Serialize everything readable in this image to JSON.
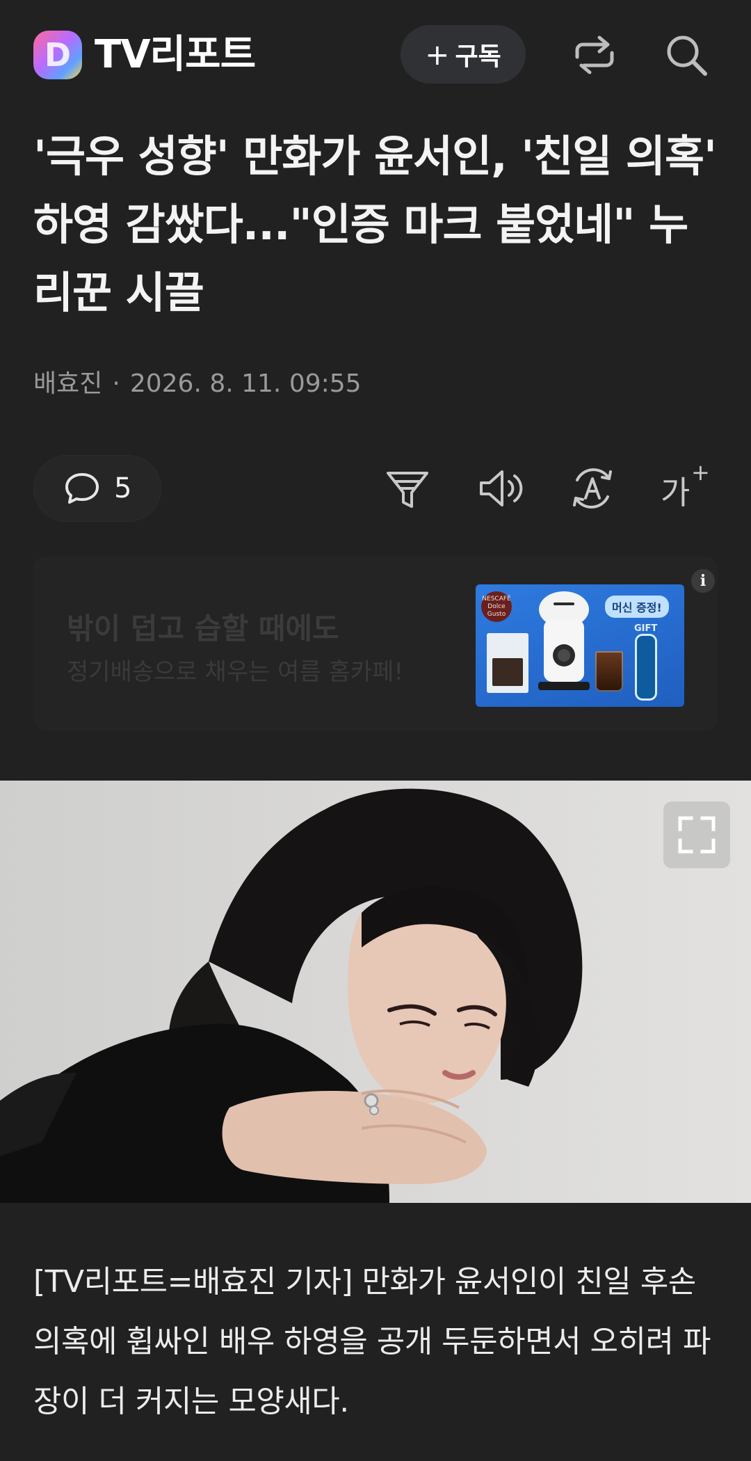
{
  "header": {
    "logo_letter": "D",
    "brand": "TV리포트",
    "subscribe_label": "구독",
    "subscribe_icon": "plus-icon",
    "share_icon": "share-icon",
    "search_icon": "search-icon"
  },
  "article": {
    "headline": "'극우 성향' 만화가 윤서인, '친일 의혹' 하영 감쌌다...\"인증 마크 붙었네\" 누리꾼 시끌",
    "author": "배효진",
    "separator": "·",
    "timestamp": "2026. 8. 11. 09:55",
    "comment_count": "5",
    "tools": [
      "comment-icon",
      "filter-icon",
      "speaker-icon",
      "translate-icon",
      "font-size-icon"
    ],
    "font_tool_glyph": "가",
    "font_tool_sup": "+",
    "body": "[TV리포트=배효진 기자] 만화가 윤서인이 친일 후손 의혹에 휩싸인 배우 하영을 공개 두둔하면서 오히려 파장이 더 커지는 모양새다."
  },
  "ad": {
    "title": "밖이 덥고 습할 때에도",
    "subtitle": "정기배송으로 채우는 여름 홈카페!",
    "image_brand": "NESCAFÉ Dolce Gusto",
    "image_promo": "머신 증정!",
    "image_gift": "GIFT",
    "info_label": "i"
  },
  "photo": {
    "expand_icon": "expand-icon"
  }
}
